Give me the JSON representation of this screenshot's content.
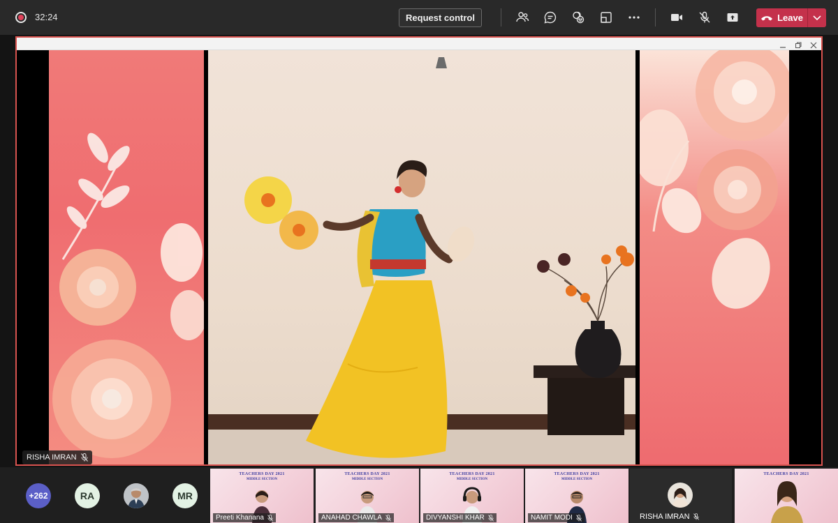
{
  "topbar": {
    "timer": "32:24",
    "request_control_label": "Request control",
    "leave_label": "Leave",
    "icons": [
      "participants-icon",
      "chat-icon",
      "reactions-icon",
      "rooms-icon",
      "more-icon",
      "camera-icon",
      "mic-off-icon",
      "share-icon"
    ]
  },
  "stage": {
    "presenter_name": "RISHA IMRAN"
  },
  "colors": {
    "leave": "#c4314b",
    "accent": "#5b5fc7",
    "share_border": "#d9534f"
  },
  "participants": {
    "more_count": "+262",
    "avatar_ra": "RA",
    "avatar_mr": "MR"
  },
  "tiles": [
    {
      "title": "TEACHERS DAY 2021",
      "subtitle": "MIDDLE SECTION",
      "name": "Preeti Khanana"
    },
    {
      "title": "TEACHERS DAY 2021",
      "subtitle": "MIDDLE SECTION",
      "name": "ANAHAD CHAWLA"
    },
    {
      "title": "TEACHERS DAY 2021",
      "subtitle": "MIDDLE SECTION",
      "name": "DIVYANSHI KHAR"
    },
    {
      "title": "TEACHERS DAY 2021",
      "subtitle": "MIDDLE SECTION",
      "name": "NAMIT MODI"
    }
  ],
  "dark_tile_name": "RISHA IMRAN",
  "last_tile_title": "TEACHERS DAY 2021"
}
